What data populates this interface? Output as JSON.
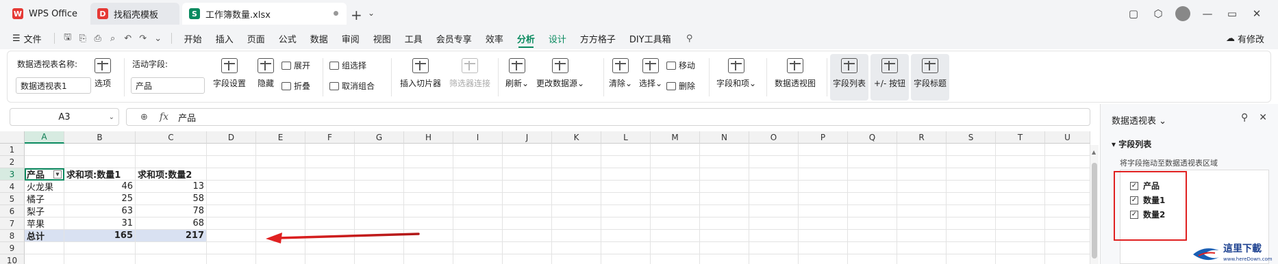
{
  "tabs": [
    {
      "label": "WPS Office",
      "icon": "wps-logo-icon"
    },
    {
      "label": "找稻壳模板",
      "icon": "docer-icon"
    },
    {
      "label": "工作簿数量.xlsx",
      "icon": "spreadsheet-icon"
    }
  ],
  "menu": {
    "file": "文件",
    "items": [
      "开始",
      "插入",
      "页面",
      "公式",
      "数据",
      "审阅",
      "视图",
      "工具",
      "会员专享",
      "效率",
      "分析",
      "设计",
      "方方格子",
      "DIY工具箱"
    ],
    "active": "分析",
    "edit_label": "有修改"
  },
  "ribbon": {
    "pivot_name_label": "数据透视表名称:",
    "pivot_name_value": "数据透视表1",
    "options": "选项",
    "active_field_label": "活动字段:",
    "active_field_value": "产品",
    "field_settings": "字段设置",
    "hide": "隐藏",
    "expand": "展开",
    "collapse": "折叠",
    "group_select": "组选择",
    "ungroup": "取消组合",
    "insert_slicer": "插入切片器",
    "filter_connect": "筛选器连接",
    "refresh": "刷新",
    "change_source": "更改数据源",
    "clear": "清除",
    "select": "选择",
    "move": "移动",
    "delete": "删除",
    "fields_items": "字段和项",
    "pivot_view": "数据透视图",
    "field_list": "字段列表",
    "plus_minus": "+/- 按钮",
    "field_header": "字段标题"
  },
  "formula": {
    "namebox": "A3",
    "fx": "fx",
    "value": "产品"
  },
  "sheet": {
    "columns": [
      "A",
      "B",
      "C",
      "D",
      "E",
      "F",
      "G",
      "H",
      "I",
      "J",
      "K",
      "L",
      "M",
      "N",
      "O",
      "P",
      "Q",
      "R",
      "S",
      "T",
      "U"
    ],
    "rows": [
      "1",
      "2",
      "3",
      "4",
      "5",
      "6",
      "7",
      "8",
      "9",
      "10"
    ],
    "header": [
      "产品",
      "求和项:数量1",
      "求和项:数量2"
    ],
    "data": [
      [
        "火龙果",
        "46",
        "13"
      ],
      [
        "橘子",
        "25",
        "58"
      ],
      [
        "梨子",
        "63",
        "78"
      ],
      [
        "苹果",
        "31",
        "68"
      ]
    ],
    "total": [
      "总计",
      "165",
      "217"
    ]
  },
  "pane": {
    "title": "数据透视表",
    "section": "字段列表",
    "hint": "将字段拖动至数据透视表区域",
    "fields": [
      {
        "label": "产品",
        "checked": true
      },
      {
        "label": "数量1",
        "checked": true
      },
      {
        "label": "数量2",
        "checked": true
      }
    ]
  },
  "colors": {
    "accent": "#0a8a5f",
    "total_row": "#d9e1f2",
    "annotation": "#e02020"
  }
}
